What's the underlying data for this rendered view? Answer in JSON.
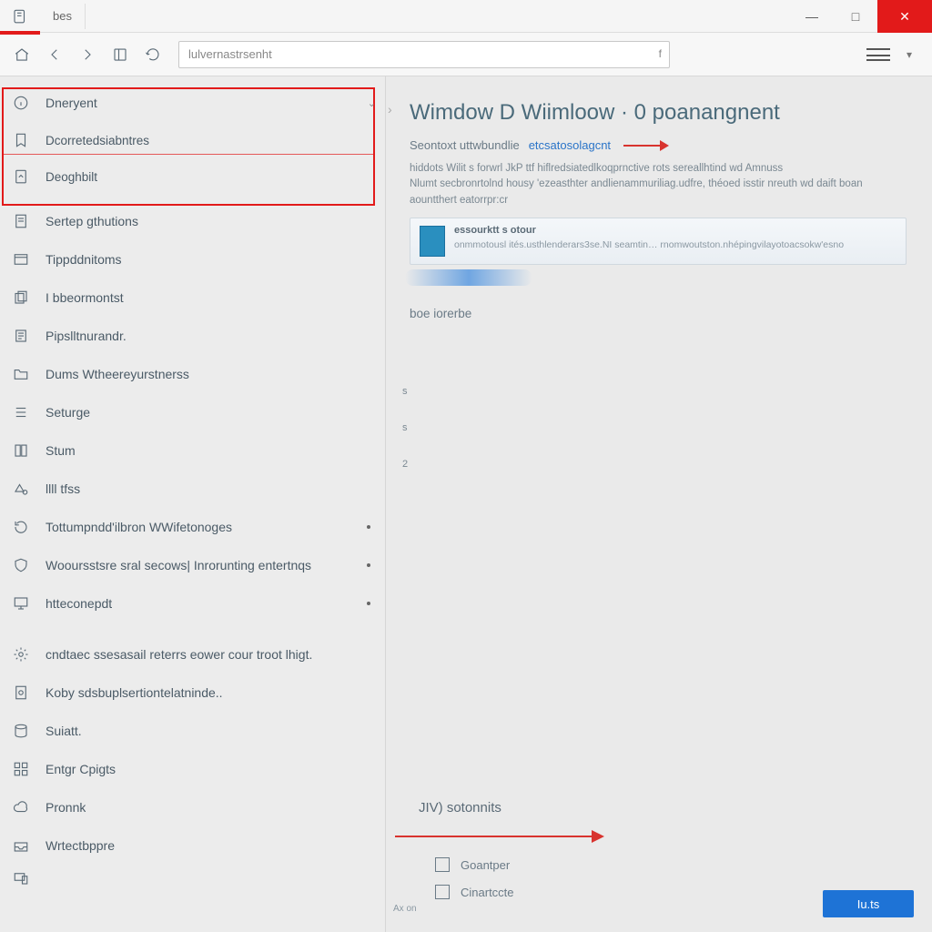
{
  "titlebar": {
    "tab_label": "bes",
    "minimize": "—",
    "maximize": "□",
    "close": "✕"
  },
  "toolbar": {
    "address_text": "lulvernastrsenht",
    "search_hint": "f"
  },
  "sidebar": {
    "items": [
      {
        "label": "Dneryent",
        "icon": "info-icon",
        "expandable": true
      },
      {
        "label": "Dcorretedsiabntres",
        "icon": "bookmark-icon"
      },
      {
        "label": "Deoghbilt",
        "icon": "page-icon"
      },
      {
        "label": "Sertep gthutions",
        "icon": "doc-icon"
      },
      {
        "label": "Tippddnitoms",
        "icon": "window-icon"
      },
      {
        "label": "I bbeormontst",
        "icon": "stack-icon"
      },
      {
        "label": "Pipslltnurandr.",
        "icon": "note-icon"
      },
      {
        "label": "Dums Wtheereyurstnerss",
        "icon": "folder-icon"
      },
      {
        "label": "Seturge",
        "icon": "list-icon"
      },
      {
        "label": "Stum",
        "icon": "book-icon"
      },
      {
        "label": "llll tfss",
        "icon": "shape-icon"
      },
      {
        "label": "Tottumpndd'ilbron WWifetonoges",
        "icon": "loop-icon",
        "dot": true
      },
      {
        "label": "Wooursstsre sral secows| Inrorunting entertnqs",
        "icon": "shield-icon",
        "dot": true
      },
      {
        "label": "htteconepdt",
        "icon": "monitor-icon",
        "dot": true
      }
    ],
    "group2": [
      {
        "label": "cndtaec ssesasail reterrs eower cour troot lhigt.",
        "icon": "gear-icon"
      },
      {
        "label": "Koby sdsbuplsertiontelatninde..",
        "icon": "page2-icon"
      },
      {
        "label": "Suiatt.",
        "icon": "db-icon"
      },
      {
        "label": "Entgr Cpigts",
        "icon": "grid-icon"
      },
      {
        "label": "Pronnk",
        "icon": "cloud-icon"
      },
      {
        "label": "Wrtectbppre",
        "icon": "tray-icon"
      }
    ],
    "extra_last_icon": "device-icon"
  },
  "content": {
    "title": "Wimdow D  Wiimloow · 0  poanangnent",
    "sub_label": "Seontoxt uttwbundlie",
    "sub_link": "etcsatosolagcnt",
    "desc_line1": "hiddots  Wilit s  forwrl  JkP ttf hiflredsiatedlkoqprnctive  rots sereallhtind  wd Amnuss",
    "desc_line2": "Nlumt secbronrtolnd housy 'ezeasthter andlienammuriliag.udfre,  théoed isstir nreuth wd daift boan aountthert eatorrpr:cr",
    "card_title": "essourktt s otour",
    "card_body": "onmmotousl ités.usthlenderars3se.NI seamtin…      rnomwoutston.nhépingvilayotoacsokw'esno",
    "section_label": "boe iorerbe",
    "mini_1": "s",
    "mini_2": "s",
    "mini_3": "2",
    "bottom_title": "JIV) sotonnits",
    "bottom_items": [
      {
        "label": "Goantper",
        "icon": "page3-icon"
      },
      {
        "label": "Cinartccte",
        "icon": "square-icon"
      }
    ],
    "tiny_ax": "Ax  on",
    "button_label": "Iu.ts"
  },
  "colors": {
    "accent_red": "#e21a1a",
    "accent_blue": "#1e73d6",
    "link_blue": "#2a74c8"
  }
}
